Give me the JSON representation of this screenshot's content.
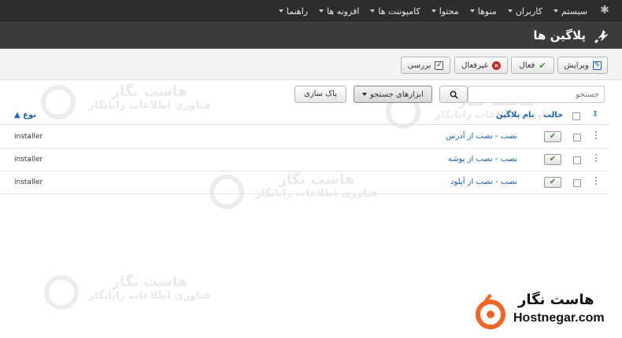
{
  "nav": {
    "items": [
      {
        "label": "سیستم"
      },
      {
        "label": "کاربران"
      },
      {
        "label": "منوها"
      },
      {
        "label": "محتوا"
      },
      {
        "label": "کامپوننت ها"
      },
      {
        "label": "افزونه ها"
      },
      {
        "label": "راهنما"
      }
    ]
  },
  "header": {
    "title": "پلاگین ها"
  },
  "toolbar": {
    "edit_label": "ویرایش",
    "enable_label": "فعال",
    "disable_label": "غیرفعال",
    "check_label": "بررسی"
  },
  "filters": {
    "search_placeholder": "جستجو",
    "search_tools_label": "ابزارهای جستجو",
    "clear_label": "پاک سازی"
  },
  "table": {
    "col_status": "حالت",
    "col_name": "نام پلاگین",
    "col_type": "نوع",
    "rows": [
      {
        "name": "نصب - نصب از آدرس",
        "type": "installer",
        "enabled": true
      },
      {
        "name": "نصب - نصب از پوشه",
        "type": "installer",
        "enabled": true
      },
      {
        "name": "نصب - نصب از آپلود",
        "type": "installer",
        "enabled": true
      }
    ]
  },
  "watermark": {
    "title": "هاست نگار",
    "subtitle": "فناوری اطلاعات رایانگار"
  },
  "brand": {
    "name_fa": "هاست نگار",
    "name_en": "Hostnegar.com",
    "color": "#f26522"
  }
}
